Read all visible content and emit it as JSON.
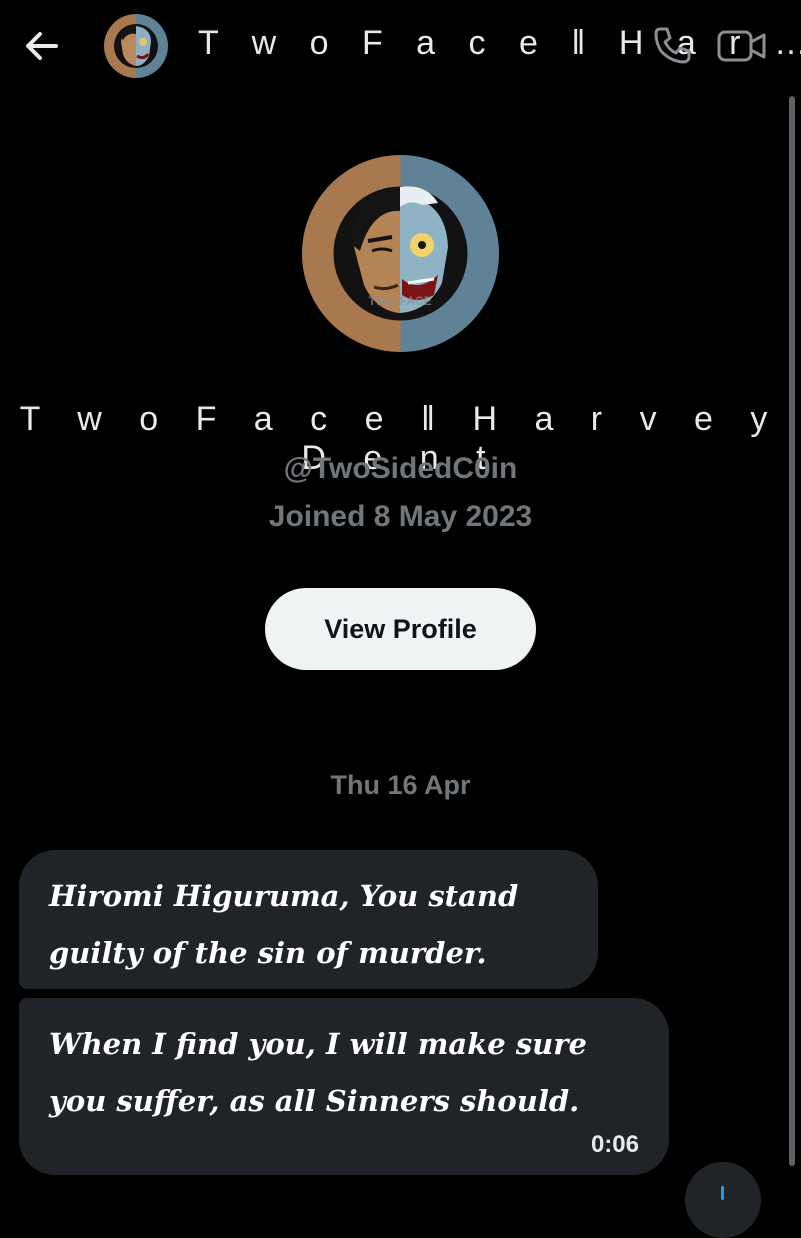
{
  "header": {
    "title": "T w o  F a c e ‖ H a r …",
    "back_icon": "arrow-left-icon",
    "call_icon": "phone-icon",
    "video_icon": "video-camera-icon"
  },
  "profile": {
    "display_name": "T w o  F a c e ‖ H a r v e y  D e n t",
    "handle": "@TwoSidedC0in",
    "joined": "Joined 8 May 2023",
    "view_profile_label": "View Profile",
    "avatar_watermark": "TWO FACE"
  },
  "conversation": {
    "date_separator": "Thu 16 Apr",
    "messages": [
      {
        "text": "Hiromi Higuruma, You stand guilty of the sin of murder."
      },
      {
        "text": "When I find you, I will make sure you suffer, as all Sinners should.",
        "time": "0:06"
      }
    ]
  },
  "colors": {
    "background": "#000000",
    "bubble": "#202327",
    "muted_text": "#71767b",
    "button_bg": "#eff3f4",
    "accent": "#1d9bf0",
    "avatar_left": "#a8784e",
    "avatar_right": "#5f8296"
  }
}
